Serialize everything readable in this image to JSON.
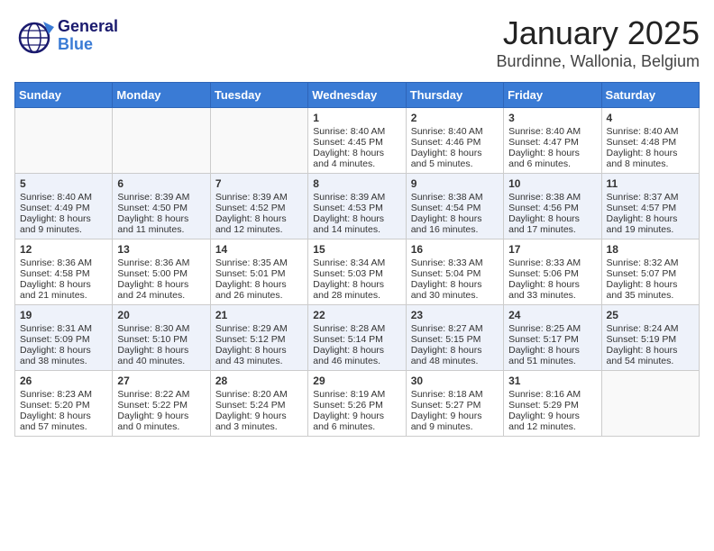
{
  "header": {
    "logo_general": "General",
    "logo_blue": "Blue",
    "title": "January 2025",
    "subtitle": "Burdinne, Wallonia, Belgium"
  },
  "calendar": {
    "weekdays": [
      "Sunday",
      "Monday",
      "Tuesday",
      "Wednesday",
      "Thursday",
      "Friday",
      "Saturday"
    ],
    "weeks": [
      [
        {
          "day": "",
          "sunrise": "",
          "sunset": "",
          "daylight": ""
        },
        {
          "day": "",
          "sunrise": "",
          "sunset": "",
          "daylight": ""
        },
        {
          "day": "",
          "sunrise": "",
          "sunset": "",
          "daylight": ""
        },
        {
          "day": "1",
          "sunrise": "Sunrise: 8:40 AM",
          "sunset": "Sunset: 4:45 PM",
          "daylight": "Daylight: 8 hours and 4 minutes."
        },
        {
          "day": "2",
          "sunrise": "Sunrise: 8:40 AM",
          "sunset": "Sunset: 4:46 PM",
          "daylight": "Daylight: 8 hours and 5 minutes."
        },
        {
          "day": "3",
          "sunrise": "Sunrise: 8:40 AM",
          "sunset": "Sunset: 4:47 PM",
          "daylight": "Daylight: 8 hours and 6 minutes."
        },
        {
          "day": "4",
          "sunrise": "Sunrise: 8:40 AM",
          "sunset": "Sunset: 4:48 PM",
          "daylight": "Daylight: 8 hours and 8 minutes."
        }
      ],
      [
        {
          "day": "5",
          "sunrise": "Sunrise: 8:40 AM",
          "sunset": "Sunset: 4:49 PM",
          "daylight": "Daylight: 8 hours and 9 minutes."
        },
        {
          "day": "6",
          "sunrise": "Sunrise: 8:39 AM",
          "sunset": "Sunset: 4:50 PM",
          "daylight": "Daylight: 8 hours and 11 minutes."
        },
        {
          "day": "7",
          "sunrise": "Sunrise: 8:39 AM",
          "sunset": "Sunset: 4:52 PM",
          "daylight": "Daylight: 8 hours and 12 minutes."
        },
        {
          "day": "8",
          "sunrise": "Sunrise: 8:39 AM",
          "sunset": "Sunset: 4:53 PM",
          "daylight": "Daylight: 8 hours and 14 minutes."
        },
        {
          "day": "9",
          "sunrise": "Sunrise: 8:38 AM",
          "sunset": "Sunset: 4:54 PM",
          "daylight": "Daylight: 8 hours and 16 minutes."
        },
        {
          "day": "10",
          "sunrise": "Sunrise: 8:38 AM",
          "sunset": "Sunset: 4:56 PM",
          "daylight": "Daylight: 8 hours and 17 minutes."
        },
        {
          "day": "11",
          "sunrise": "Sunrise: 8:37 AM",
          "sunset": "Sunset: 4:57 PM",
          "daylight": "Daylight: 8 hours and 19 minutes."
        }
      ],
      [
        {
          "day": "12",
          "sunrise": "Sunrise: 8:36 AM",
          "sunset": "Sunset: 4:58 PM",
          "daylight": "Daylight: 8 hours and 21 minutes."
        },
        {
          "day": "13",
          "sunrise": "Sunrise: 8:36 AM",
          "sunset": "Sunset: 5:00 PM",
          "daylight": "Daylight: 8 hours and 24 minutes."
        },
        {
          "day": "14",
          "sunrise": "Sunrise: 8:35 AM",
          "sunset": "Sunset: 5:01 PM",
          "daylight": "Daylight: 8 hours and 26 minutes."
        },
        {
          "day": "15",
          "sunrise": "Sunrise: 8:34 AM",
          "sunset": "Sunset: 5:03 PM",
          "daylight": "Daylight: 8 hours and 28 minutes."
        },
        {
          "day": "16",
          "sunrise": "Sunrise: 8:33 AM",
          "sunset": "Sunset: 5:04 PM",
          "daylight": "Daylight: 8 hours and 30 minutes."
        },
        {
          "day": "17",
          "sunrise": "Sunrise: 8:33 AM",
          "sunset": "Sunset: 5:06 PM",
          "daylight": "Daylight: 8 hours and 33 minutes."
        },
        {
          "day": "18",
          "sunrise": "Sunrise: 8:32 AM",
          "sunset": "Sunset: 5:07 PM",
          "daylight": "Daylight: 8 hours and 35 minutes."
        }
      ],
      [
        {
          "day": "19",
          "sunrise": "Sunrise: 8:31 AM",
          "sunset": "Sunset: 5:09 PM",
          "daylight": "Daylight: 8 hours and 38 minutes."
        },
        {
          "day": "20",
          "sunrise": "Sunrise: 8:30 AM",
          "sunset": "Sunset: 5:10 PM",
          "daylight": "Daylight: 8 hours and 40 minutes."
        },
        {
          "day": "21",
          "sunrise": "Sunrise: 8:29 AM",
          "sunset": "Sunset: 5:12 PM",
          "daylight": "Daylight: 8 hours and 43 minutes."
        },
        {
          "day": "22",
          "sunrise": "Sunrise: 8:28 AM",
          "sunset": "Sunset: 5:14 PM",
          "daylight": "Daylight: 8 hours and 46 minutes."
        },
        {
          "day": "23",
          "sunrise": "Sunrise: 8:27 AM",
          "sunset": "Sunset: 5:15 PM",
          "daylight": "Daylight: 8 hours and 48 minutes."
        },
        {
          "day": "24",
          "sunrise": "Sunrise: 8:25 AM",
          "sunset": "Sunset: 5:17 PM",
          "daylight": "Daylight: 8 hours and 51 minutes."
        },
        {
          "day": "25",
          "sunrise": "Sunrise: 8:24 AM",
          "sunset": "Sunset: 5:19 PM",
          "daylight": "Daylight: 8 hours and 54 minutes."
        }
      ],
      [
        {
          "day": "26",
          "sunrise": "Sunrise: 8:23 AM",
          "sunset": "Sunset: 5:20 PM",
          "daylight": "Daylight: 8 hours and 57 minutes."
        },
        {
          "day": "27",
          "sunrise": "Sunrise: 8:22 AM",
          "sunset": "Sunset: 5:22 PM",
          "daylight": "Daylight: 9 hours and 0 minutes."
        },
        {
          "day": "28",
          "sunrise": "Sunrise: 8:20 AM",
          "sunset": "Sunset: 5:24 PM",
          "daylight": "Daylight: 9 hours and 3 minutes."
        },
        {
          "day": "29",
          "sunrise": "Sunrise: 8:19 AM",
          "sunset": "Sunset: 5:26 PM",
          "daylight": "Daylight: 9 hours and 6 minutes."
        },
        {
          "day": "30",
          "sunrise": "Sunrise: 8:18 AM",
          "sunset": "Sunset: 5:27 PM",
          "daylight": "Daylight: 9 hours and 9 minutes."
        },
        {
          "day": "31",
          "sunrise": "Sunrise: 8:16 AM",
          "sunset": "Sunset: 5:29 PM",
          "daylight": "Daylight: 9 hours and 12 minutes."
        },
        {
          "day": "",
          "sunrise": "",
          "sunset": "",
          "daylight": ""
        }
      ]
    ]
  }
}
